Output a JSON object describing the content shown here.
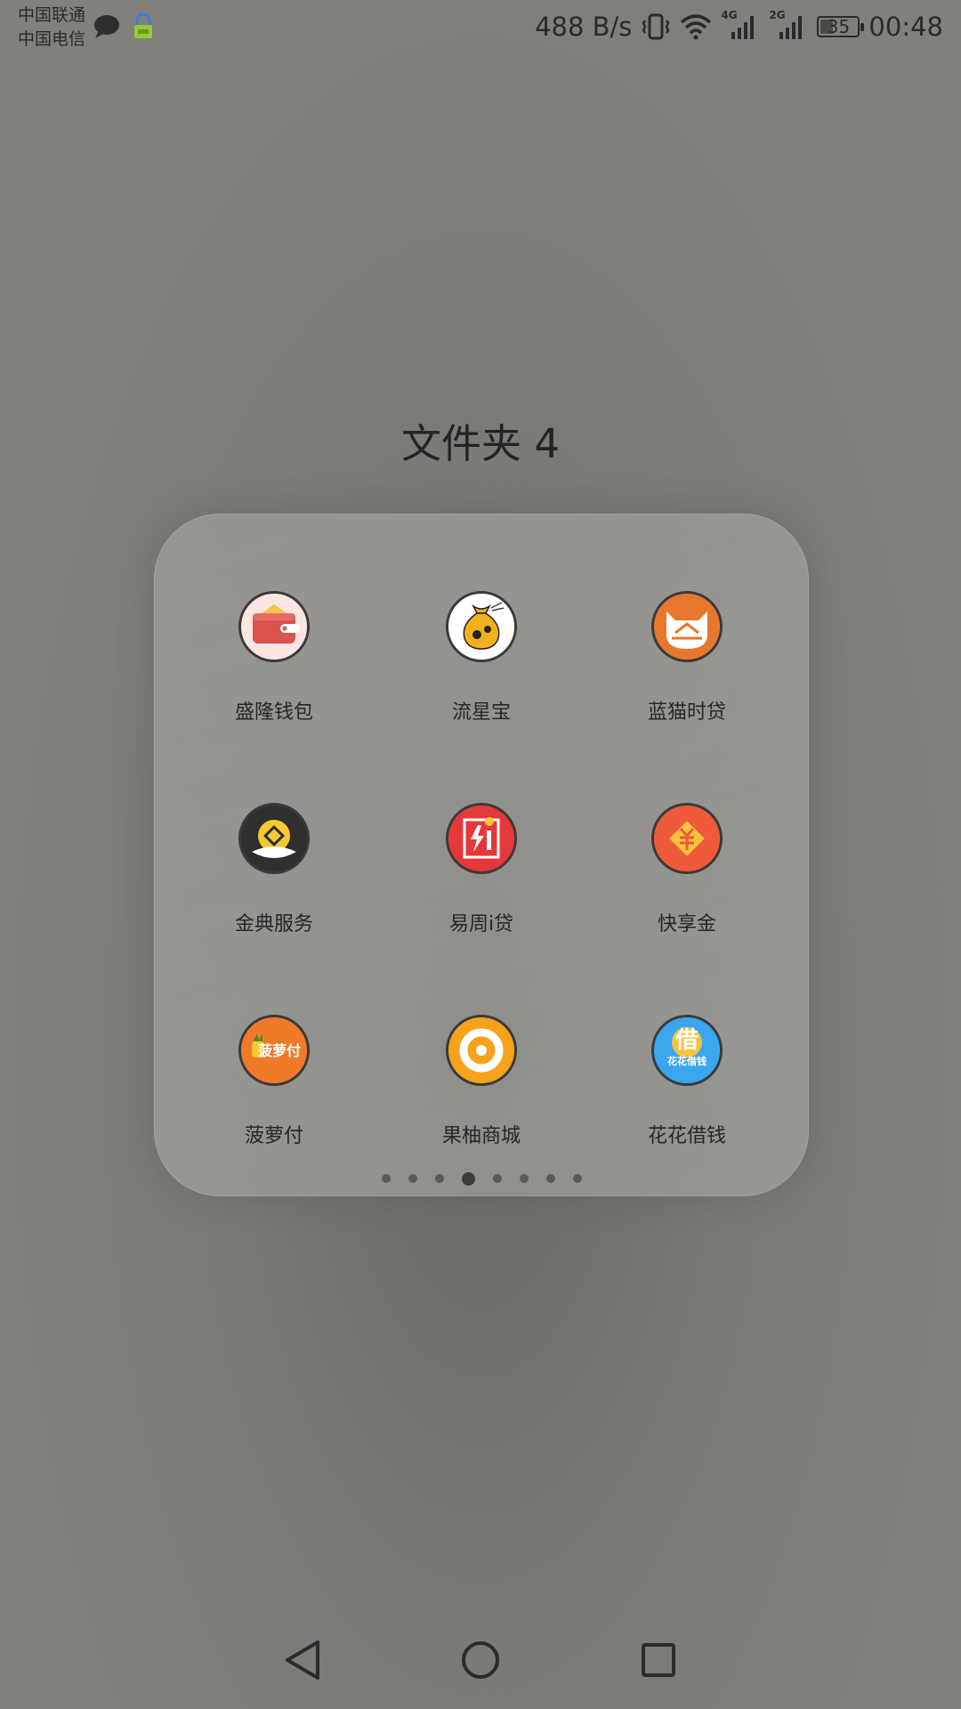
{
  "status_bar": {
    "carrier_1": "中国联通",
    "carrier_2": "中国电信",
    "net_speed": "488 B/s",
    "signal_1_label": "4G",
    "signal_2_label": "2G",
    "battery": "35",
    "time": "00:48"
  },
  "folder": {
    "title": "文件夹 4",
    "apps": [
      {
        "label": "盛隆钱包",
        "icon": "wallet-icon"
      },
      {
        "label": "流星宝",
        "icon": "money-bag-icon"
      },
      {
        "label": "蓝猫时贷",
        "icon": "cat-icon"
      },
      {
        "label": "金典服务",
        "icon": "coin-icon"
      },
      {
        "label": "易周i贷",
        "icon": "lightning-icon"
      },
      {
        "label": "快享金",
        "icon": "yuan-icon"
      },
      {
        "label": "菠萝付",
        "icon": "pineapple-pay-icon",
        "icon_text": "菠萝付"
      },
      {
        "label": "果柚商城",
        "icon": "ring-icon"
      },
      {
        "label": "花花借钱",
        "icon": "borrow-icon",
        "icon_text": "借",
        "icon_subtext": "花花借钱"
      }
    ],
    "page_count": 8,
    "active_page": 4
  },
  "colors": {
    "wallet": "#d9534f",
    "money_bag": "#f2b01e",
    "cat": "#e8772e",
    "coin_dark": "#333333",
    "lightning": "#e5383b",
    "yuan": "#ef5a3a",
    "pineapple": "#f07a2a",
    "ring": "#f7a21b",
    "borrow": "#3aa6ee"
  }
}
